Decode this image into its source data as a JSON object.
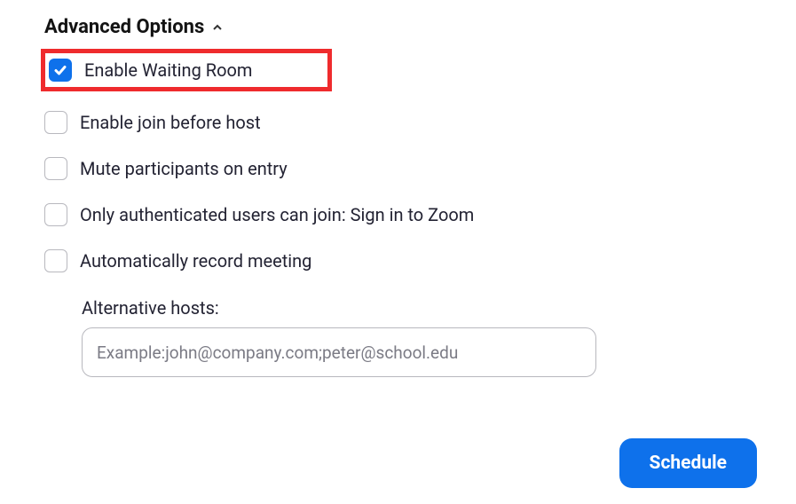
{
  "header": {
    "title": "Advanced Options"
  },
  "options": {
    "waiting_room": {
      "label": "Enable Waiting Room",
      "checked": true
    },
    "join_before_host": {
      "label": "Enable join before host",
      "checked": false
    },
    "mute_on_entry": {
      "label": "Mute participants on entry",
      "checked": false
    },
    "authenticated_only": {
      "label": "Only authenticated users can join: Sign in to Zoom",
      "checked": false
    },
    "auto_record": {
      "label": "Automatically record meeting",
      "checked": false
    }
  },
  "alternative_hosts": {
    "label": "Alternative hosts:",
    "placeholder": "Example:john@company.com;peter@school.edu",
    "value": ""
  },
  "buttons": {
    "schedule": "Schedule"
  },
  "colors": {
    "accent": "#0e71eb",
    "highlight_border": "#ef2b2d"
  }
}
